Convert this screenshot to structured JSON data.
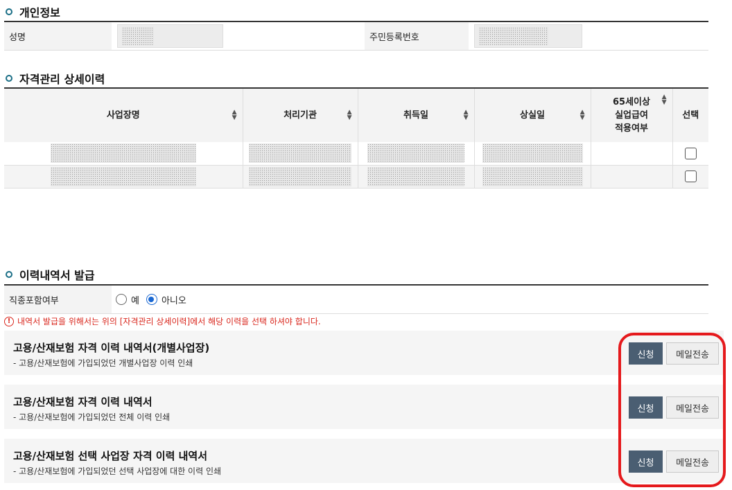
{
  "personal": {
    "title": "개인정보",
    "name_label": "성명",
    "rrn_label": "주민등록번호"
  },
  "history": {
    "title": "자격관리 상세이력",
    "columns": [
      "사업장명",
      "처리기관",
      "취득일",
      "상실일",
      "65세이상\n실업급여\n적용여부",
      "선택"
    ],
    "row_count": 2
  },
  "issuance": {
    "title": "이력내역서 발급",
    "option_label": "직종포함여부",
    "options": [
      "예",
      "아니오"
    ],
    "selected": "아니오",
    "notice": "내역서 발급을 위해서는 위의 [자격관리 상세이력]에서 해당 이력을 선택 하셔야 합니다.",
    "notice_icon": "exclamation-circle-icon",
    "documents": [
      {
        "title": "고용/산재보험 자격 이력 내역서(개별사업장)",
        "desc": "- 고용/산재보험에 가입되었던 개별사업장 이력 인쇄"
      },
      {
        "title": "고용/산재보험 자격 이력 내역서",
        "desc": "- 고용/산재보험에 가입되었던 전체 이력 인쇄"
      },
      {
        "title": "고용/산재보험 선택 사업장 자격 이력 내역서",
        "desc": "- 고용/산재보험에 가입되었던 선택 사업장에 대한 이력 인쇄"
      }
    ],
    "apply_label": "신청",
    "mail_label": "메일전송"
  },
  "colors": {
    "accent": "#1a6e86",
    "button": "#4a5e72",
    "warning": "#d9261c",
    "highlight": "#e5191c"
  }
}
